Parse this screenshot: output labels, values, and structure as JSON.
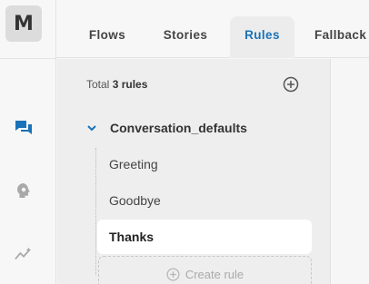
{
  "app": {
    "logo_letter": "M"
  },
  "tabs": [
    {
      "label": "Flows",
      "active": false
    },
    {
      "label": "Stories",
      "active": false
    },
    {
      "label": "Rules",
      "active": true
    },
    {
      "label": "Fallback",
      "active": false
    }
  ],
  "rail": {
    "icons": [
      "chat-icon",
      "bot-settings-icon",
      "analytics-icon"
    ],
    "active_icon": "chat-icon"
  },
  "rules_panel": {
    "total_prefix": "Total",
    "total_count": "3 rules",
    "group": {
      "label": "Conversation_defaults",
      "expanded": true
    },
    "items": [
      {
        "label": "Greeting",
        "selected": false
      },
      {
        "label": "Goodbye",
        "selected": false
      },
      {
        "label": "Thanks",
        "selected": true
      }
    ],
    "create_label": "Create rule"
  },
  "colors": {
    "accent": "#1a73b8",
    "rail_bg": "#f7f7f7",
    "panel_bg": "#eeeeee"
  }
}
